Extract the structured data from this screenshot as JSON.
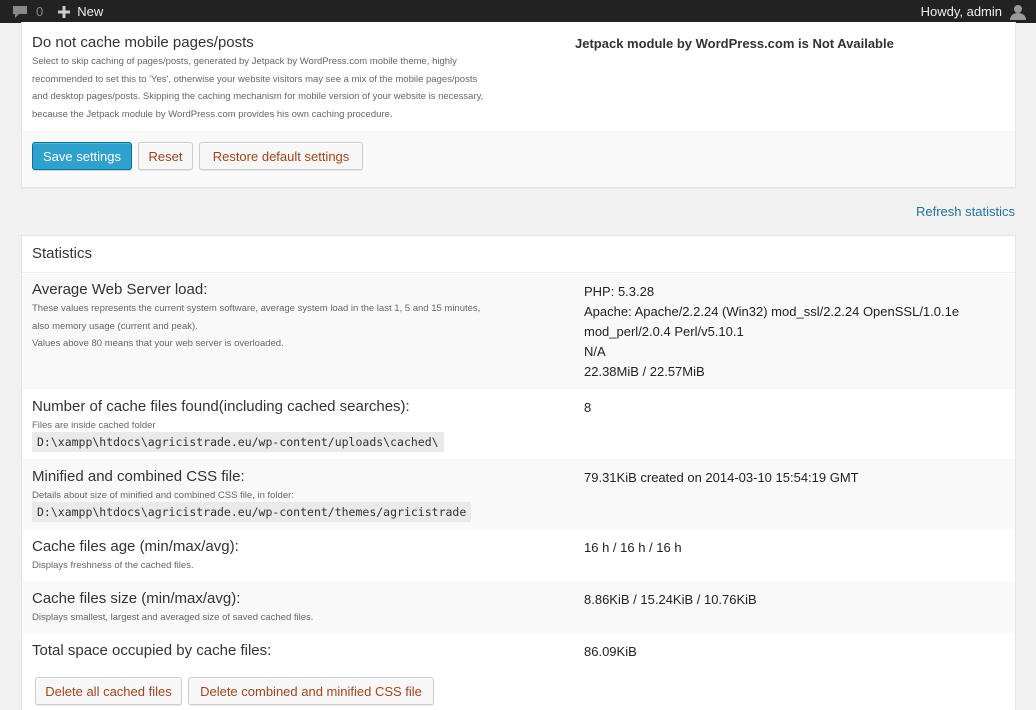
{
  "adminbar": {
    "comment_count": "0",
    "new_label": "New",
    "howdy": "Howdy, admin"
  },
  "mobile_cache": {
    "title": "Do not cache mobile pages/posts",
    "desc_lines": [
      "Select to skip caching of pages/posts, generated by Jetpack by WordPress.com mobile theme, highly",
      "recommended to set this to 'Yes', otherwise your website visitors may see a mix of the mobile pages/posts",
      "and desktop pages/posts. Skipping the caching mechanism for mobile version of your website is necessary,",
      "because the Jetpack module by WordPress.com provides his own caching procedure."
    ],
    "status": "Jetpack module by WordPress.com is Not Available"
  },
  "settings_buttons": {
    "save": "Save settings",
    "reset": "Reset",
    "restore": "Restore default settings"
  },
  "refresh_link": "Refresh statistics",
  "statistics": {
    "header": "Statistics",
    "load": {
      "title": "Average Web Server load:",
      "desc_lines": [
        "These values represents the current system software, average system load in the last 1, 5 and 15 minutes,",
        "also memory usage (current and peak).",
        "Values above 80 means that your web server is overloaded."
      ],
      "values": [
        "PHP: 5.3.28",
        "Apache: Apache/2.2.24 (Win32) mod_ssl/2.2.24 OpenSSL/1.0.1e",
        "mod_perl/2.0.4 Perl/v5.10.1",
        "N/A",
        "22.38MiB / 22.57MiB"
      ]
    },
    "cache_files": {
      "title": "Number of cache files found(including cached searches):",
      "desc": "Files are inside cached folder",
      "path": "D:\\xampp\\htdocs\\agricistrade.eu/wp-content/uploads\\cached\\",
      "value": "8"
    },
    "css_file": {
      "title": "Minified and combined CSS file:",
      "desc": "Details about size of minified and combined CSS file, in folder:",
      "path": "D:\\xampp\\htdocs\\agricistrade.eu/wp-content/themes/agricistrade",
      "value": "79.31KiB created on 2014-03-10 15:54:19 GMT"
    },
    "age": {
      "title": "Cache files age (min/max/avg):",
      "desc": "Displays freshness of the cached files.",
      "value": "16 h / 16 h / 16 h"
    },
    "size": {
      "title": "Cache files size (min/max/avg):",
      "desc": "Displays smallest, largest and averaged size of saved cached files.",
      "value": "8.86KiB / 15.24KiB / 10.76KiB"
    },
    "total": {
      "title": "Total space occupied by cache files:",
      "value": "86.09KiB"
    },
    "buttons": {
      "delete_cached": "Delete all cached files",
      "delete_css": "Delete combined and minified CSS file"
    }
  }
}
